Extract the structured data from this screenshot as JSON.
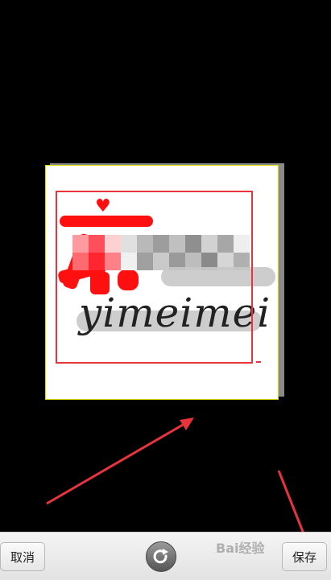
{
  "toolbar": {
    "cancel_label": "取消",
    "save_label": "保存",
    "rotate_icon": "rotate-icon"
  },
  "watermark": {
    "text": "Bai经验"
  },
  "image_content": {
    "script_text": "yimeimei"
  },
  "colors": {
    "selection_border": "#e8343a",
    "arrow": "#e8343a",
    "logo_red": "#ff1010"
  }
}
